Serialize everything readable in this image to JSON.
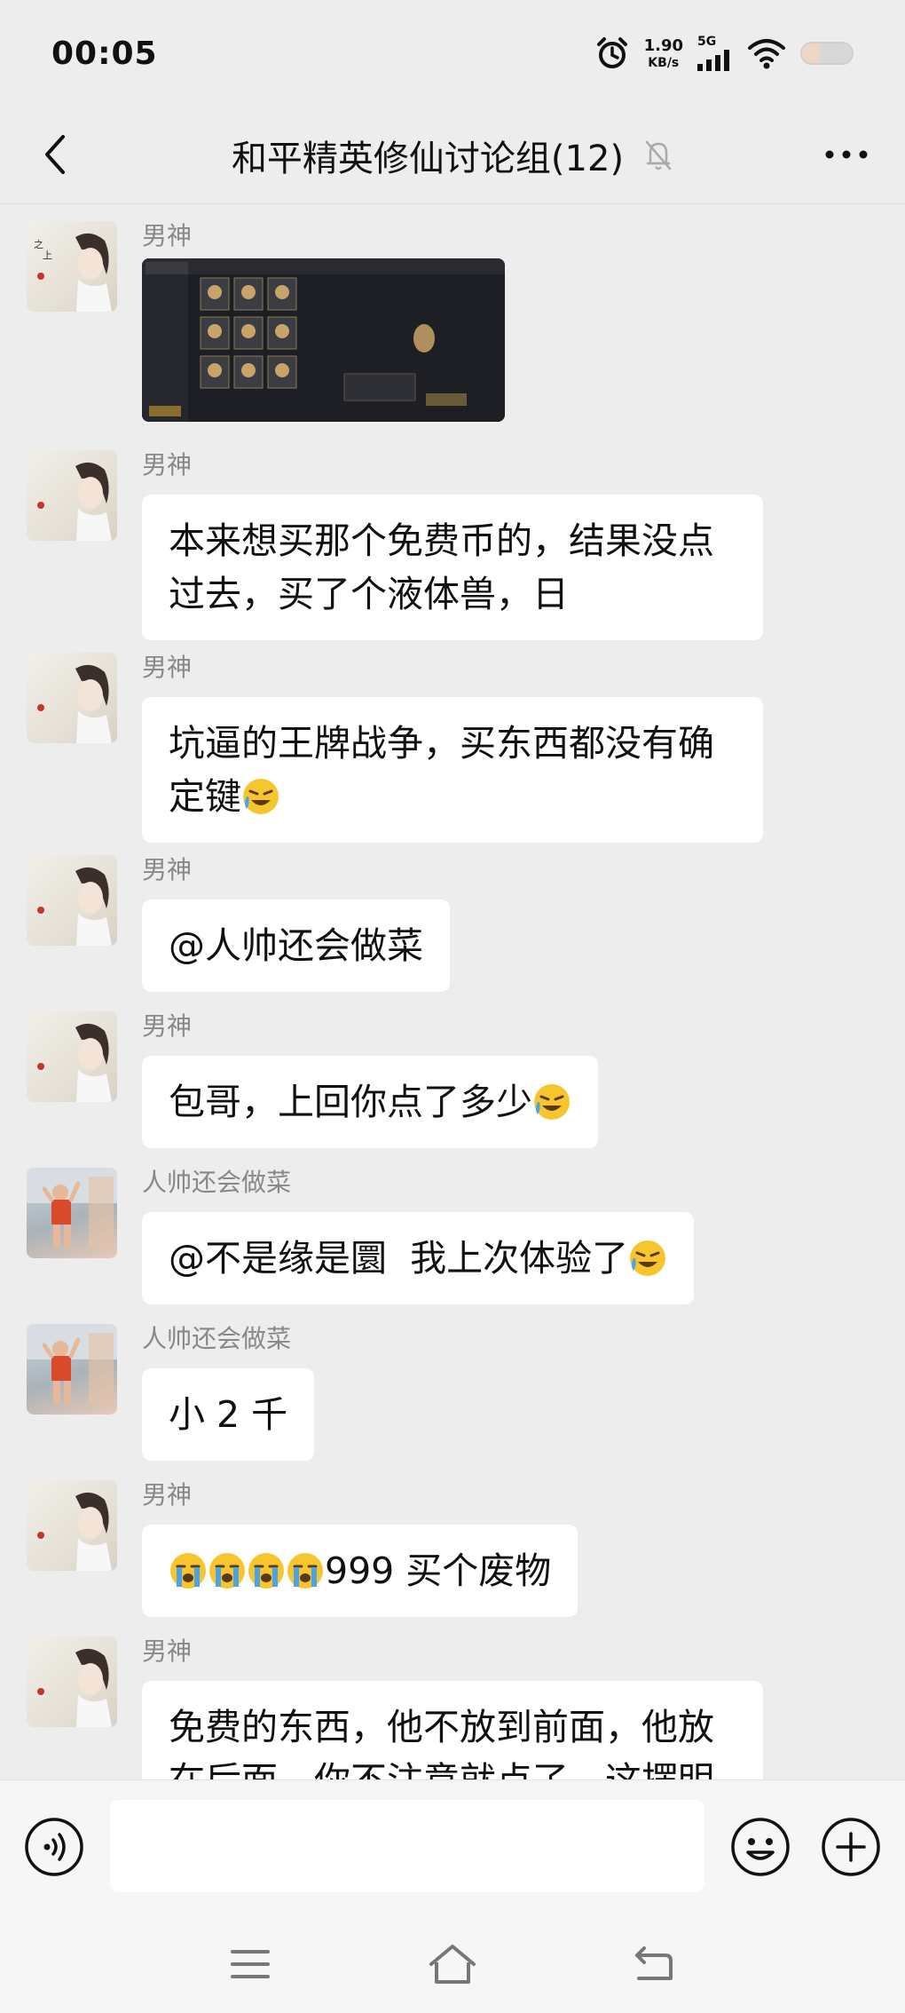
{
  "status_bar": {
    "time": "00:05",
    "net_speed_value": "1.90",
    "net_speed_unit": "KB/s",
    "network_label": "5G",
    "battery_level": 0.35
  },
  "header": {
    "title": "和平精英修仙讨论组(12)"
  },
  "messages": [
    {
      "sender": "男神",
      "type": "image",
      "avatar": "anime-avatar"
    },
    {
      "sender": "男神",
      "type": "text",
      "lines": [
        "本来想买那个免费币的，结果没点",
        "过去，买了个液体兽，日"
      ]
    },
    {
      "sender": "男神",
      "type": "text",
      "lines": [
        "坑逼的王牌战争，买东西都没有确",
        "定键"
      ],
      "emoji": "crying-laughing"
    },
    {
      "sender": "男神",
      "type": "text",
      "lines": [
        "@人帅还会做菜"
      ]
    },
    {
      "sender": "男神",
      "type": "text",
      "lines": [
        "包哥，上回你点了多少"
      ],
      "emoji": "crying-laughing"
    },
    {
      "sender": "人帅还会做菜",
      "type": "text",
      "lines": [
        "@不是缘是圜  我上次体验了"
      ],
      "emoji": "crying-laughing"
    },
    {
      "sender": "人帅还会做菜",
      "type": "text",
      "lines": [
        "小 2 千"
      ]
    },
    {
      "sender": "男神",
      "type": "text",
      "lines": [
        "999 买个废物"
      ],
      "emoji_prefix": "loudly-crying x4"
    },
    {
      "sender": "男神",
      "type": "text",
      "lines": [
        "免费的东西，他不放到前面，他放",
        "在后面，你不注意就点了，这摆明"
      ]
    }
  ],
  "colors": {
    "background": "#ededed",
    "bubble": "#ffffff",
    "sender_name": "#888888"
  }
}
